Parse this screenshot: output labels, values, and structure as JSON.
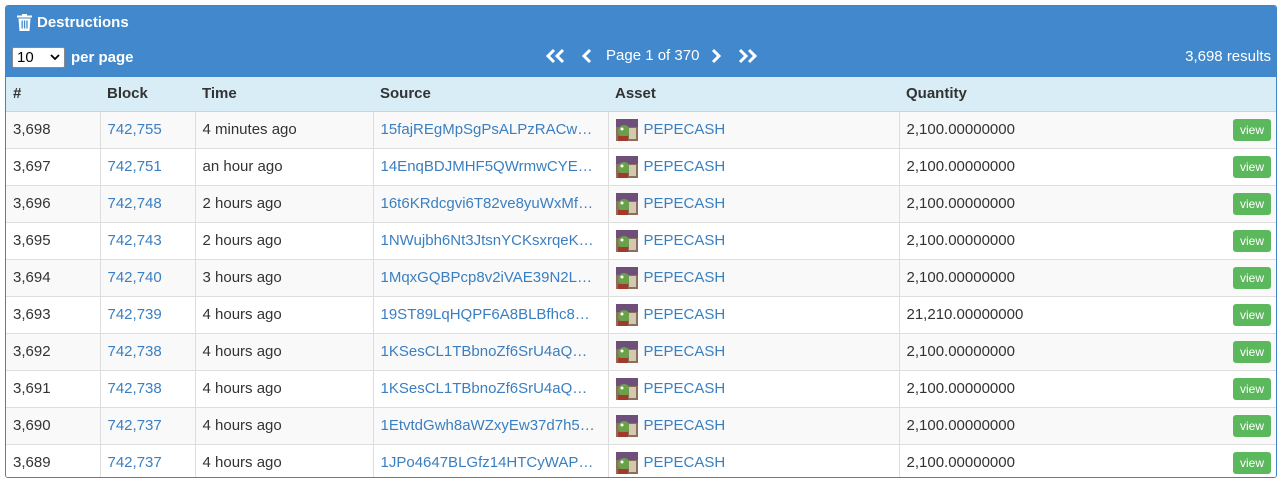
{
  "header": {
    "title": "Destructions",
    "per_page_value": "10",
    "per_page_label": "per page",
    "page_text": "Page 1 of 370",
    "results_text": "3,698 results"
  },
  "columns": [
    "#",
    "Block",
    "Time",
    "Source",
    "Asset",
    "Quantity"
  ],
  "view_label": "view",
  "colors": {
    "header_bg": "#4189cc",
    "table_header_bg": "#d9edf7",
    "link": "#3a7fc1",
    "view_button": "#5cb85c"
  },
  "rows": [
    {
      "num": "3,698",
      "block": "742,755",
      "time": "4 minutes ago",
      "source": "15fajREgMpSgPsALPzRACw…",
      "asset": "PEPECASH",
      "quantity": "2,100.00000000"
    },
    {
      "num": "3,697",
      "block": "742,751",
      "time": "an hour ago",
      "source": "14EnqBDJMHF5QWrmwCYE…",
      "asset": "PEPECASH",
      "quantity": "2,100.00000000"
    },
    {
      "num": "3,696",
      "block": "742,748",
      "time": "2 hours ago",
      "source": "16t6KRdcgvi6T82ve8yuWxMf…",
      "asset": "PEPECASH",
      "quantity": "2,100.00000000"
    },
    {
      "num": "3,695",
      "block": "742,743",
      "time": "2 hours ago",
      "source": "1NWujbh6Nt3JtsnYCKsxrqeK…",
      "asset": "PEPECASH",
      "quantity": "2,100.00000000"
    },
    {
      "num": "3,694",
      "block": "742,740",
      "time": "3 hours ago",
      "source": "1MqxGQBPcp8v2iVAE39N2L…",
      "asset": "PEPECASH",
      "quantity": "2,100.00000000"
    },
    {
      "num": "3,693",
      "block": "742,739",
      "time": "4 hours ago",
      "source": "19ST89LqHQPF6A8BLBfhc8…",
      "asset": "PEPECASH",
      "quantity": "21,210.00000000"
    },
    {
      "num": "3,692",
      "block": "742,738",
      "time": "4 hours ago",
      "source": "1KSesCL1TBbnoZf6SrU4aQ…",
      "asset": "PEPECASH",
      "quantity": "2,100.00000000"
    },
    {
      "num": "3,691",
      "block": "742,738",
      "time": "4 hours ago",
      "source": "1KSesCL1TBbnoZf6SrU4aQ…",
      "asset": "PEPECASH",
      "quantity": "2,100.00000000"
    },
    {
      "num": "3,690",
      "block": "742,737",
      "time": "4 hours ago",
      "source": "1EtvtdGwh8aWZxyEw37d7h5…",
      "asset": "PEPECASH",
      "quantity": "2,100.00000000"
    },
    {
      "num": "3,689",
      "block": "742,737",
      "time": "4 hours ago",
      "source": "1JPo4647BLGfz14HTCyWAP…",
      "asset": "PEPECASH",
      "quantity": "2,100.00000000"
    }
  ]
}
